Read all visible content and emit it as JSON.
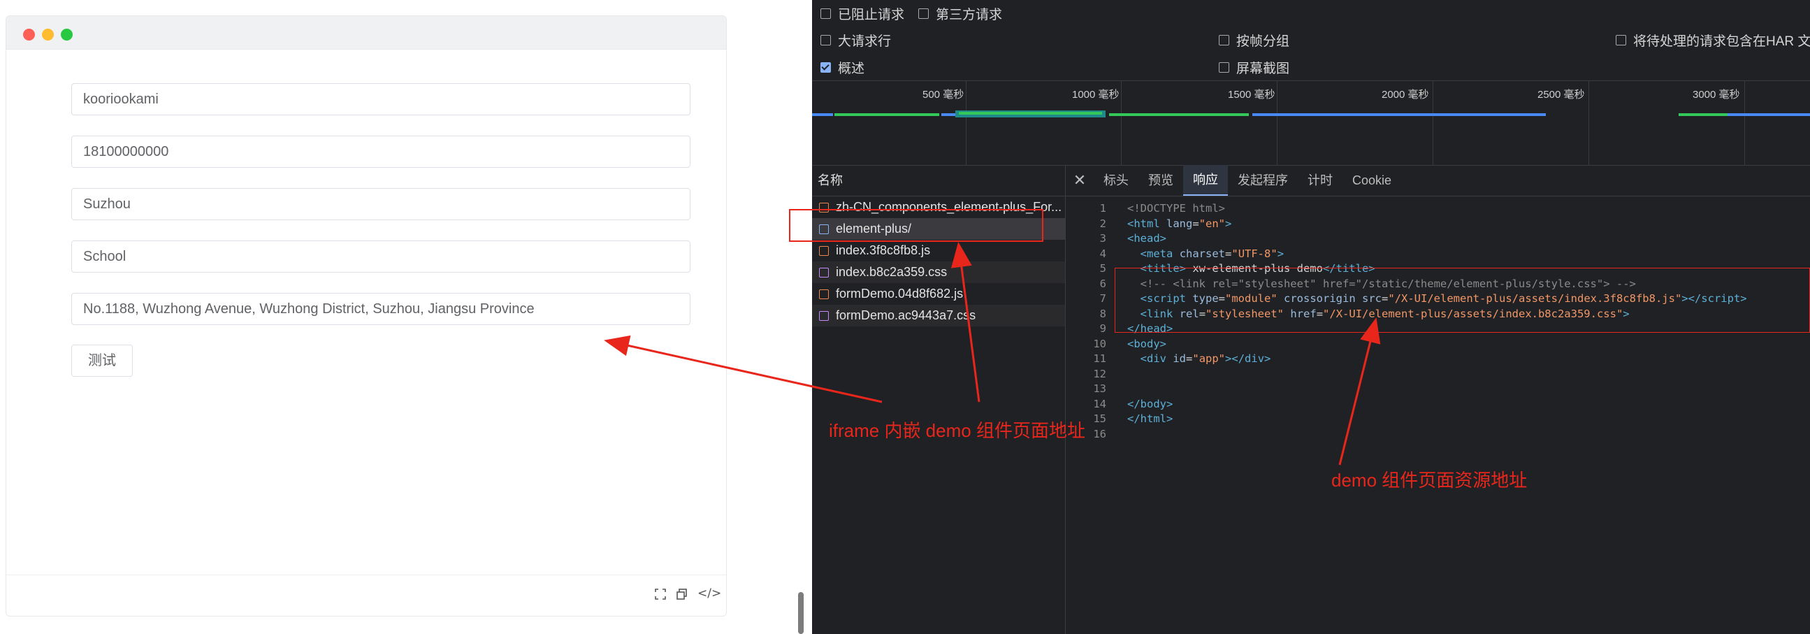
{
  "demo": {
    "fields": [
      "kooriookami",
      "18100000000",
      "Suzhou",
      "School",
      "No.1188, Wuzhong Avenue, Wuzhong District, Suzhou, Jiangsu Province"
    ],
    "button_label": "测试",
    "footer_icons": [
      "fullscreen-icon",
      "copy-icon",
      "code-icon"
    ],
    "footer_code_glyph": "</>"
  },
  "devtools": {
    "checkboxes": {
      "blocked_requests": {
        "label": "已阻止请求",
        "checked": false
      },
      "third_party": {
        "label": "第三方请求",
        "checked": false
      },
      "big_rows": {
        "label": "大请求行",
        "checked": false
      },
      "group_by_frame": {
        "label": "按帧分组",
        "checked": false
      },
      "har_pending": {
        "label": "将待处理的请求包含在HAR 文件",
        "checked": false
      },
      "overview": {
        "label": "概述",
        "checked": true
      },
      "screenshots": {
        "label": "屏幕截图",
        "checked": false
      }
    },
    "timeline_ticks": [
      "500 毫秒",
      "1000 毫秒",
      "1500 毫秒",
      "2000 毫秒",
      "2500 毫秒",
      "3000 毫秒"
    ],
    "list_header": "名称",
    "requests": [
      {
        "name": "zh-CN_components_element-plus_For...",
        "type": "script"
      },
      {
        "name": "element-plus/",
        "type": "document"
      },
      {
        "name": "index.3f8c8fb8.js",
        "type": "script"
      },
      {
        "name": "index.b8c2a359.css",
        "type": "stylesheet"
      },
      {
        "name": "formDemo.04d8f682.js",
        "type": "script"
      },
      {
        "name": "formDemo.ac9443a7.css",
        "type": "stylesheet"
      }
    ],
    "tabs": [
      "标头",
      "预览",
      "响应",
      "发起程序",
      "计时",
      "Cookie"
    ],
    "active_tab": "响应",
    "code_line_numbers": [
      "1",
      "2",
      "3",
      "4",
      "5",
      "6",
      "7",
      "8",
      "9",
      "10",
      "11",
      "12",
      "13",
      "14",
      "15",
      "16"
    ]
  },
  "annotations": {
    "iframe_label": "iframe 内嵌 demo 组件页面地址",
    "resource_label": "demo 组件页面资源地址"
  },
  "colors": {
    "annotation_red": "#e8261c",
    "devtools_bg": "#202124",
    "timeline_green": "#34c759",
    "timeline_blue": "#4a8af4"
  }
}
